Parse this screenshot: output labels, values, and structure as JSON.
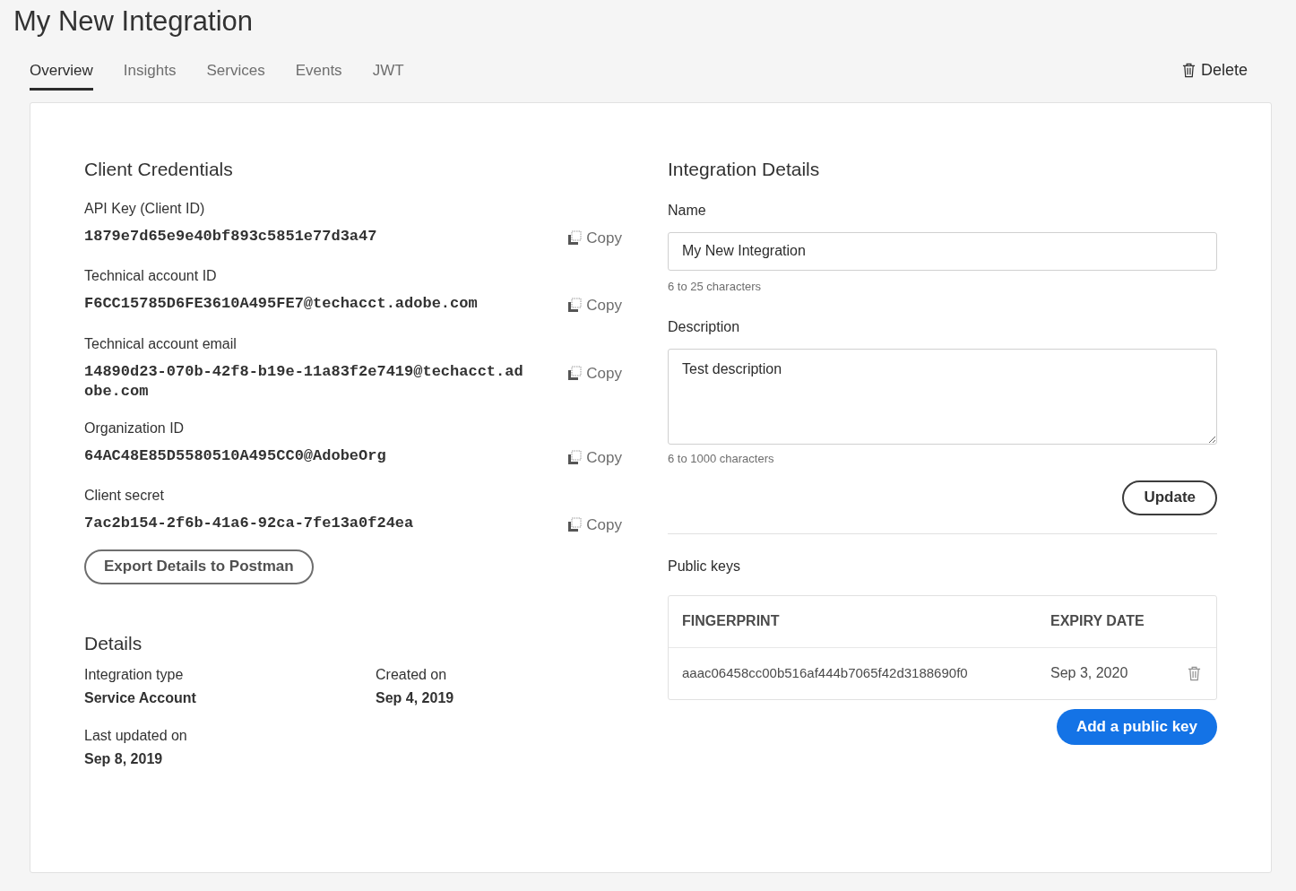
{
  "page_title": "My New Integration",
  "tabs": [
    {
      "label": "Overview",
      "selected": true
    },
    {
      "label": "Insights",
      "selected": false
    },
    {
      "label": "Services",
      "selected": false
    },
    {
      "label": "Events",
      "selected": false
    },
    {
      "label": "JWT",
      "selected": false
    }
  ],
  "delete_button": "Delete",
  "client_credentials": {
    "heading": "Client Credentials",
    "fields": [
      {
        "label": "API Key (Client ID)",
        "value": "1879e7d65e9e40bf893c5851e77d3a47",
        "copy_label": "Copy"
      },
      {
        "label": "Technical account ID",
        "value": "F6CC15785D6FE3610A495FE7@techacct.adobe.com",
        "copy_label": "Copy"
      },
      {
        "label": "Technical account email",
        "value": "14890d23-070b-42f8-b19e-11a83f2e7419@techacct.adobe.com",
        "copy_label": "Copy"
      },
      {
        "label": "Organization ID",
        "value": "64AC48E85D5580510A495CC0@AdobeOrg",
        "copy_label": "Copy"
      },
      {
        "label": "Client secret",
        "value": "7ac2b154-2f6b-41a6-92ca-7fe13a0f24ea",
        "copy_label": "Copy"
      }
    ],
    "export_button": "Export Details to Postman"
  },
  "details": {
    "heading": "Details",
    "items": [
      {
        "label": "Integration type",
        "value": "Service Account"
      },
      {
        "label": "Created on",
        "value": "Sep 4, 2019"
      },
      {
        "label": "Last updated on",
        "value": "Sep 8, 2019"
      }
    ]
  },
  "integration_details": {
    "heading": "Integration Details",
    "name": {
      "label": "Name",
      "value": "My New Integration",
      "hint": "6 to 25 characters"
    },
    "description": {
      "label": "Description",
      "value": "Test description",
      "hint": "6 to 1000 characters"
    },
    "update_button": "Update"
  },
  "public_keys": {
    "heading": "Public keys",
    "columns": [
      "FINGERPRINT",
      "EXPIRY DATE"
    ],
    "rows": [
      {
        "fingerprint": "aaac06458cc00b516af444b7065f42d3188690f0",
        "expiry_date": "Sep 3, 2020"
      }
    ],
    "add_button": "Add a public key"
  }
}
